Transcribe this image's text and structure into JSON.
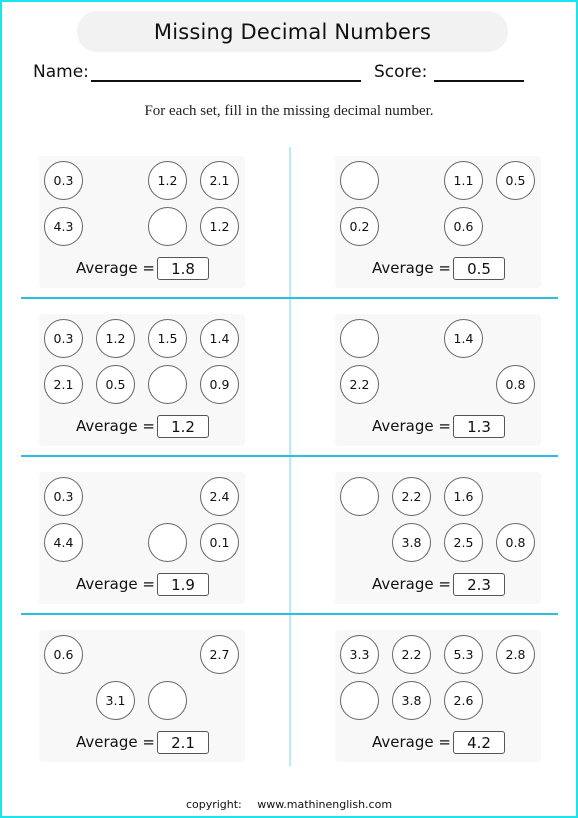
{
  "title": "Missing Decimal Numbers",
  "header": {
    "name_label": "Name:",
    "score_label": "Score:"
  },
  "instructions": "For each set, fill in the missing decimal number.",
  "average_label": "Average =",
  "colors": {
    "page_border": "#19e6ea",
    "grid_line": "#2bbde6",
    "vertical_divider": "#b7ecf6",
    "panel_bg": "#f8f8f8",
    "title_bg": "#f2f2f2"
  },
  "sets": [
    {
      "average": "1.8",
      "cells": [
        [
          "0.3",
          null,
          "1.2",
          "2.1"
        ],
        [
          "4.3",
          null,
          "",
          "1.2"
        ]
      ]
    },
    {
      "average": "0.5",
      "cells": [
        [
          "",
          null,
          "1.1",
          "0.5"
        ],
        [
          "0.2",
          null,
          "0.6",
          null
        ]
      ]
    },
    {
      "average": "1.2",
      "cells": [
        [
          "0.3",
          "1.2",
          "1.5",
          "1.4"
        ],
        [
          "2.1",
          "0.5",
          "",
          "0.9"
        ]
      ]
    },
    {
      "average": "1.3",
      "cells": [
        [
          "",
          null,
          "1.4",
          null
        ],
        [
          "2.2",
          null,
          null,
          "0.8"
        ]
      ]
    },
    {
      "average": "1.9",
      "cells": [
        [
          "0.3",
          null,
          null,
          "2.4"
        ],
        [
          "4.4",
          null,
          "",
          "0.1"
        ]
      ]
    },
    {
      "average": "2.3",
      "cells": [
        [
          "",
          "2.2",
          "1.6",
          null
        ],
        [
          null,
          "3.8",
          "2.5",
          "0.8"
        ]
      ]
    },
    {
      "average": "2.1",
      "cells": [
        [
          "0.6",
          null,
          null,
          "2.7"
        ],
        [
          null,
          "3.1",
          "",
          null
        ]
      ]
    },
    {
      "average": "4.2",
      "cells": [
        [
          "3.3",
          "2.2",
          "5.3",
          "2.8"
        ],
        [
          "",
          "3.8",
          "2.6",
          null
        ]
      ]
    }
  ],
  "footer": {
    "copyright_label": "copyright:",
    "website": "www.mathinenglish.com"
  }
}
